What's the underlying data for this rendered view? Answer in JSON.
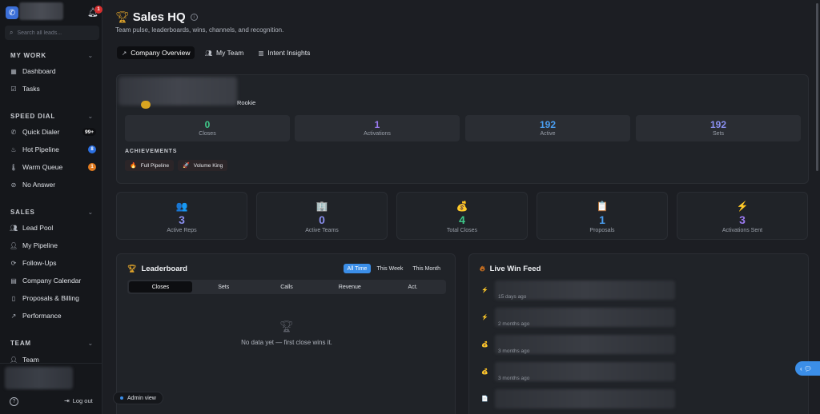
{
  "sidebar": {
    "notification_count": "1",
    "search_placeholder": "Search all leads...",
    "sections": [
      {
        "title": "MY WORK",
        "items": [
          {
            "label": "Dashboard",
            "icon": "grid-icon"
          },
          {
            "label": "Tasks",
            "icon": "checkbox-icon"
          }
        ]
      },
      {
        "title": "SPEED DIAL",
        "items": [
          {
            "label": "Quick Dialer",
            "icon": "phone-icon",
            "badge": "99+"
          },
          {
            "label": "Hot Pipeline",
            "icon": "flame-icon",
            "badge": "8"
          },
          {
            "label": "Warm Queue",
            "icon": "thermometer-icon",
            "badge": "1"
          },
          {
            "label": "No Answer",
            "icon": "phone-off-icon"
          }
        ]
      },
      {
        "title": "SALES",
        "items": [
          {
            "label": "Lead Pool",
            "icon": "users-icon"
          },
          {
            "label": "My Pipeline",
            "icon": "user-check-icon"
          },
          {
            "label": "Follow-Ups",
            "icon": "refresh-icon"
          },
          {
            "label": "Company Calendar",
            "icon": "calendar-icon"
          },
          {
            "label": "Proposals & Billing",
            "icon": "document-icon"
          },
          {
            "label": "Performance",
            "icon": "trend-icon"
          }
        ]
      },
      {
        "title": "TEAM",
        "items": [
          {
            "label": "Team",
            "icon": "user-icon"
          }
        ]
      }
    ],
    "logout_label": "Log out"
  },
  "header": {
    "title": "Sales HQ",
    "subtitle": "Team pulse, leaderboards, wins, channels, and recognition."
  },
  "tabs": [
    {
      "label": "Company Overview",
      "icon": "trend-icon",
      "active": true
    },
    {
      "label": "My Team",
      "icon": "users-icon",
      "active": false
    },
    {
      "label": "Intent Insights",
      "icon": "bar-chart-icon",
      "active": false
    }
  ],
  "profile": {
    "rank": "Rookie",
    "stats": [
      {
        "value": "0",
        "label": "Closes",
        "color": "#3fc98a"
      },
      {
        "value": "1",
        "label": "Activations",
        "color": "#9b7af0"
      },
      {
        "value": "192",
        "label": "Active",
        "color": "#4a9ef0"
      },
      {
        "value": "192",
        "label": "Sets",
        "color": "#8a8ff0"
      }
    ],
    "achievements_title": "ACHIEVEMENTS",
    "achievements": [
      {
        "label": "Full Pipeline",
        "icon": "flame-icon"
      },
      {
        "label": "Volume King",
        "icon": "rocket-icon"
      }
    ]
  },
  "metrics": [
    {
      "value": "3",
      "label": "Active Reps",
      "icon": "users-icon",
      "glyph": "👥",
      "color": "#8a8ff0"
    },
    {
      "value": "0",
      "label": "Active Teams",
      "icon": "building-icon",
      "glyph": "🏢",
      "color": "#8a8ff0"
    },
    {
      "value": "4",
      "label": "Total Closes",
      "icon": "money-bag-icon",
      "glyph": "💰",
      "color": "#3fc98a"
    },
    {
      "value": "1",
      "label": "Proposals",
      "icon": "clipboard-icon",
      "glyph": "📋",
      "color": "#4a9ef0"
    },
    {
      "value": "3",
      "label": "Activations Sent",
      "icon": "bolt-icon",
      "glyph": "⚡",
      "color": "#9b7af0"
    }
  ],
  "leaderboard": {
    "title": "Leaderboard",
    "ranges": [
      {
        "label": "All Time",
        "active": true
      },
      {
        "label": "This Week",
        "active": false
      },
      {
        "label": "This Month",
        "active": false
      }
    ],
    "metric_tabs": [
      {
        "label": "Closes",
        "active": true
      },
      {
        "label": "Sets",
        "active": false
      },
      {
        "label": "Calls",
        "active": false
      },
      {
        "label": "Revenue",
        "active": false
      },
      {
        "label": "Act.",
        "active": false
      }
    ],
    "empty_text": "No data yet — first close wins it."
  },
  "feed": {
    "title": "Live Win Feed",
    "items": [
      {
        "time": "15 days ago",
        "icon": "bolt-icon",
        "glyph": "⚡"
      },
      {
        "time": "2 months ago",
        "icon": "bolt-icon",
        "glyph": "⚡"
      },
      {
        "time": "3 months ago",
        "icon": "money-bag-icon",
        "glyph": "💰"
      },
      {
        "time": "3 months ago",
        "icon": "money-bag-icon",
        "glyph": "💰"
      },
      {
        "time": "",
        "icon": "document-icon",
        "glyph": "📄"
      }
    ]
  },
  "admin_view_label": "Admin view"
}
